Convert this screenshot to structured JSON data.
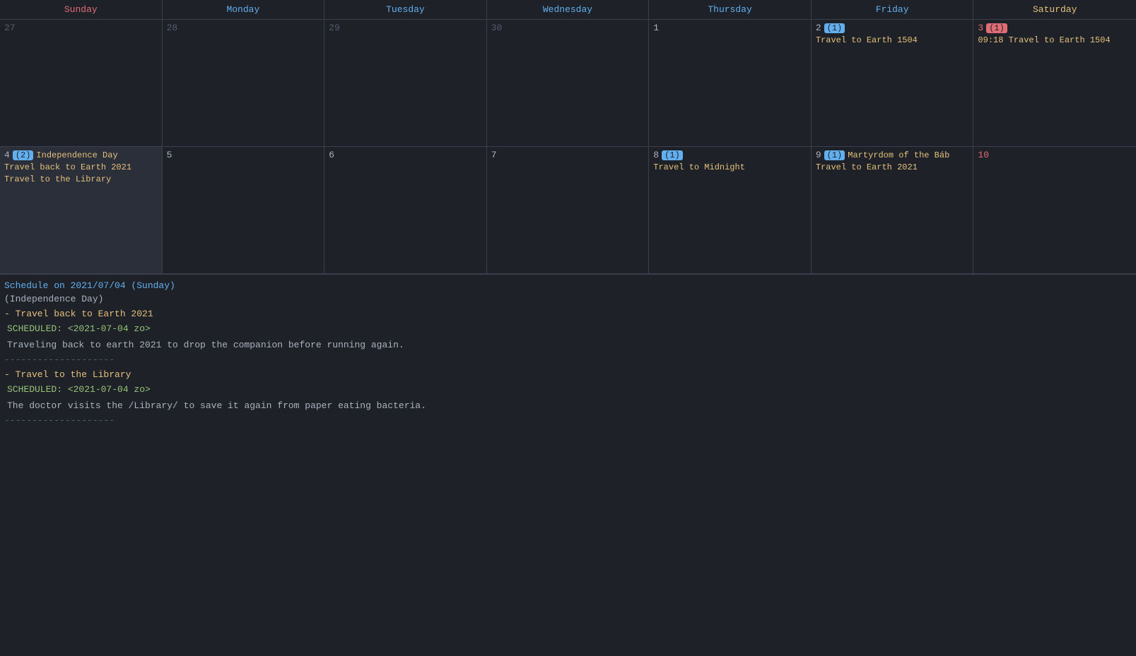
{
  "calendar": {
    "headers": [
      {
        "label": "Sunday",
        "class": "header-sunday"
      },
      {
        "label": "Monday",
        "class": "header-monday"
      },
      {
        "label": "Tuesday",
        "class": "header-tuesday"
      },
      {
        "label": "Wednesday",
        "class": "header-wednesday"
      },
      {
        "label": "Thursday",
        "class": "header-thursday"
      },
      {
        "label": "Friday",
        "class": "header-friday"
      },
      {
        "label": "Saturday",
        "class": "header-saturday"
      }
    ],
    "row1": [
      {
        "date": "27",
        "dateClass": "dim-date",
        "events": []
      },
      {
        "date": "28",
        "dateClass": "dim-date",
        "events": []
      },
      {
        "date": "29",
        "dateClass": "dim-date",
        "events": []
      },
      {
        "date": "30",
        "dateClass": "dim-date",
        "events": []
      },
      {
        "date": "1",
        "dateClass": "date-num",
        "events": []
      },
      {
        "date": "2",
        "dateClass": "date-num",
        "badge": "(1)",
        "badgeClass": "date-badge",
        "events": [
          {
            "text": "Travel to Earth 1504",
            "class": "event-line"
          }
        ]
      },
      {
        "date": "3",
        "dateClass": "date-num-red",
        "badge": "(1)",
        "badgeClass": "date-badge-red",
        "events": [
          {
            "text": "09:18 Travel to Earth 1504",
            "class": "event-line"
          }
        ]
      }
    ],
    "row2": [
      {
        "date": "4",
        "dateClass": "date-num",
        "badge": "(2)",
        "badgeClass": "date-badge",
        "holiday": "Independence Day",
        "selected": true,
        "events": [
          {
            "text": "Travel back to Earth 2021",
            "class": "event-line"
          },
          {
            "text": "Travel to the Library",
            "class": "event-line"
          }
        ]
      },
      {
        "date": "5",
        "dateClass": "date-num",
        "events": []
      },
      {
        "date": "6",
        "dateClass": "date-num",
        "events": []
      },
      {
        "date": "7",
        "dateClass": "date-num",
        "events": []
      },
      {
        "date": "8",
        "dateClass": "date-num",
        "badge": "(1)",
        "badgeClass": "date-badge",
        "events": [
          {
            "text": "Travel to Midnight",
            "class": "event-line"
          }
        ]
      },
      {
        "date": "9",
        "dateClass": "date-num",
        "badge": "(1)",
        "badgeClass": "date-badge",
        "holiday": "Martyrdom of the Báb",
        "events": [
          {
            "text": "Travel to Earth 2021",
            "class": "event-line"
          }
        ]
      },
      {
        "date": "10",
        "dateClass": "date-num-red",
        "events": []
      }
    ]
  },
  "schedule": {
    "header": "Schedule on 2021/07/04 (Sunday)",
    "holiday": "(Independence Day)",
    "events": [
      {
        "title": "- Travel back to Earth 2021",
        "scheduled": "SCHEDULED: <2021-07-04 zo>",
        "description": "Traveling back to earth 2021 to drop the companion before running again."
      },
      {
        "title": "- Travel to the Library",
        "scheduled": "SCHEDULED: <2021-07-04 zo>",
        "description": "The doctor visits the /Library/ to save it again from paper eating bacteria."
      }
    ],
    "divider": "--------------------"
  }
}
